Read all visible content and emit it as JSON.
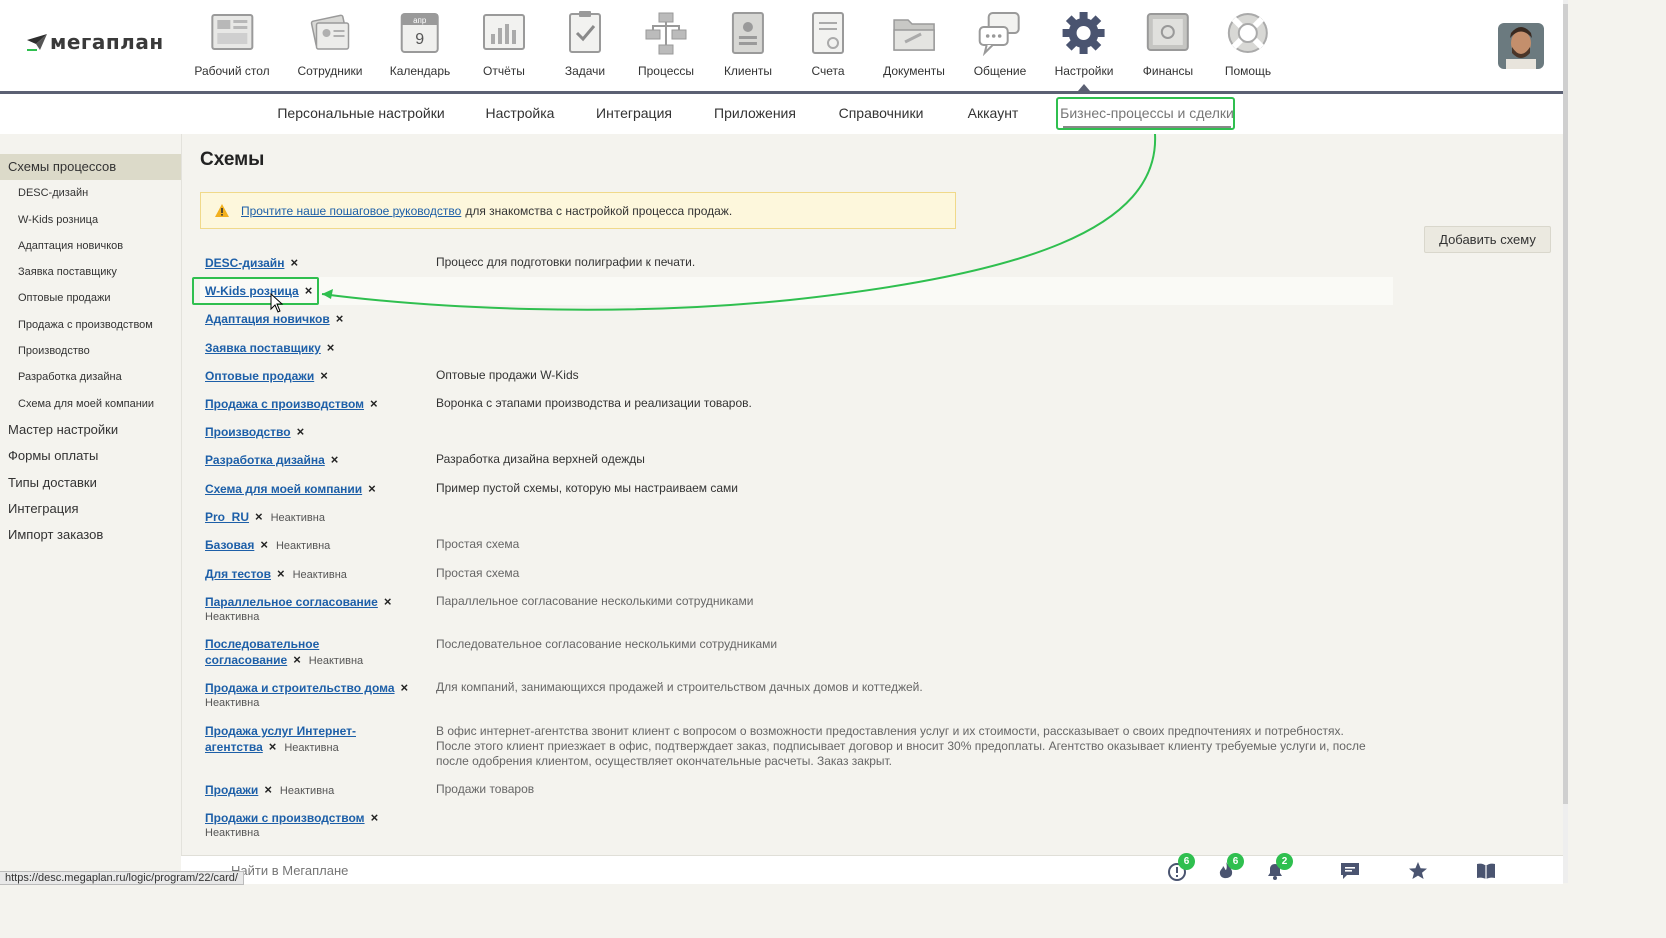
{
  "app": {
    "logo_text": "мегаплан"
  },
  "nav": {
    "items": [
      {
        "label": "Рабочий стол",
        "icon": "desktop-icon"
      },
      {
        "label": "Сотрудники",
        "icon": "employees-icon"
      },
      {
        "label": "Календарь",
        "icon": "calendar-icon",
        "calendar_month": "апр",
        "calendar_day": "9"
      },
      {
        "label": "Отчёты",
        "icon": "reports-icon"
      },
      {
        "label": "Задачи",
        "icon": "tasks-icon"
      },
      {
        "label": "Процессы",
        "icon": "processes-icon"
      },
      {
        "label": "Клиенты",
        "icon": "clients-icon"
      },
      {
        "label": "Счета",
        "icon": "invoices-icon"
      },
      {
        "label": "Документы",
        "icon": "documents-icon"
      },
      {
        "label": "Общение",
        "icon": "chat-icon"
      },
      {
        "label": "Настройки",
        "icon": "gear-icon",
        "active": true
      },
      {
        "label": "Финансы",
        "icon": "safe-icon"
      },
      {
        "label": "Помощь",
        "icon": "lifebuoy-icon"
      }
    ]
  },
  "subnav": {
    "tabs": [
      {
        "label": "Персональные настройки"
      },
      {
        "label": "Настройка"
      },
      {
        "label": "Интеграция"
      },
      {
        "label": "Приложения"
      },
      {
        "label": "Справочники"
      },
      {
        "label": "Аккаунт"
      },
      {
        "label": "Бизнес-процессы и сделки",
        "active": true
      }
    ]
  },
  "sidebar": {
    "section_title": "Схемы процессов",
    "sub_items": [
      "DESC-дизайн",
      "W-Kids розница",
      "Адаптация новичков",
      "Заявка поставщику",
      "Оптовые продажи",
      "Продажа с производством",
      "Производство",
      "Разработка дизайна",
      "Схема для моей компании"
    ],
    "items": [
      "Мастер настройки",
      "Формы оплаты",
      "Типы доставки",
      "Интеграция",
      "Импорт заказов"
    ]
  },
  "main": {
    "title": "Схемы",
    "notice": {
      "link_text": "Прочтите наше пошаговое руководство",
      "rest_text": "для знакомства с настройкой процесса продаж."
    },
    "add_button": "Добавить схему",
    "inactive_label": "Неактивна",
    "remove_glyph": "×",
    "schemes": [
      {
        "name": "DESC-дизайн",
        "desc": "Процесс для подготовки полиграфии к печати."
      },
      {
        "name": "W-Kids розница",
        "desc": ""
      },
      {
        "name": "Адаптация новичков",
        "desc": ""
      },
      {
        "name": "Заявка поставщику",
        "desc": ""
      },
      {
        "name": "Оптовые продажи",
        "desc": "Оптовые продажи W-Kids"
      },
      {
        "name": "Продажа с производством",
        "desc": "Воронка с этапами производства и реализации товаров."
      },
      {
        "name": "Производство",
        "desc": ""
      },
      {
        "name": "Разработка дизайна",
        "desc": "Разработка дизайна верхней одежды"
      },
      {
        "name": "Схема для моей компании",
        "desc": "Пример пустой схемы, которую мы настраиваем сами"
      },
      {
        "name": "Pro_RU",
        "desc": "",
        "inactive": true
      },
      {
        "name": "Базовая",
        "desc": "Простая схема",
        "inactive": true
      },
      {
        "name": "Для тестов",
        "desc": "Простая схема",
        "inactive": true
      },
      {
        "name": "Параллельное согласование",
        "desc": "Параллельное согласование несколькими сотрудниками",
        "inactive": true
      },
      {
        "name": "Последовательное согласование",
        "desc": "Последовательное согласование несколькими сотрудниками",
        "inactive": true
      },
      {
        "name": "Продажа и строительство дома",
        "desc": "Для компаний, занимающихся продажей и строительством дачных домов и коттеджей.",
        "inactive": true
      },
      {
        "name": "Продажа услуг Интернет-агентства",
        "desc": "В офис интернет-агентства звонит клиент с вопросом о возможности предоставления услуг и их стоимости, рассказывает о своих предпочтениях и потребностях. После этого клиент приезжает в офис, подтверждает заказ, подписывает договор и вносит 30% предоплаты. Агентство оказывает клиенту требуемые услуги и, после после одобрения клиентом, осуществляет окончательные расчеты. Заказ закрыт.",
        "inactive": true
      },
      {
        "name": "Продажи",
        "desc": "Продажи товаров",
        "inactive": true
      },
      {
        "name": "Продажи с производством",
        "desc": "",
        "inactive": true
      }
    ]
  },
  "footer": {
    "search_placeholder": "Найти в Мегаплане",
    "badges": {
      "alerts": "6",
      "fire": "6",
      "notifications": "2"
    }
  },
  "status_url": "https://desc.megaplan.ru/logic/program/22/card/",
  "colors": {
    "accent_green": "#2fbf4f",
    "link": "#1d5fa8",
    "nav_line": "#5b6073"
  }
}
